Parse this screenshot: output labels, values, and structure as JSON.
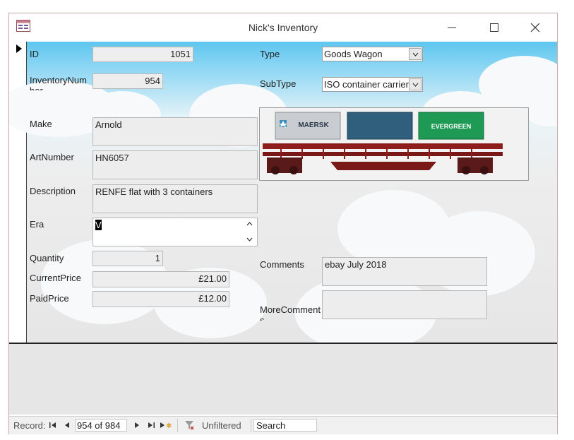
{
  "window": {
    "title": "Nick's Inventory"
  },
  "fields": {
    "id": {
      "label": "ID",
      "value": "1051"
    },
    "inventory_number": {
      "label": "InventoryNumber",
      "value": "954"
    },
    "make": {
      "label": "Make",
      "value": "Arnold"
    },
    "art_number": {
      "label": "ArtNumber",
      "value": "HN6057"
    },
    "description": {
      "label": "Description",
      "value": "RENFE flat with 3 containers"
    },
    "era": {
      "label": "Era",
      "value": "V"
    },
    "quantity": {
      "label": "Quantity",
      "value": "1"
    },
    "current_price": {
      "label": "CurrentPrice",
      "value": "£21.00"
    },
    "paid_price": {
      "label": "PaidPrice",
      "value": "£12.00"
    },
    "type": {
      "label": "Type",
      "value": "Goods Wagon"
    },
    "sub_type": {
      "label": "SubType",
      "value": "ISO container carrier"
    },
    "comments": {
      "label": "Comments",
      "value": "ebay July 2018"
    },
    "more_comments": {
      "label": "MoreComments",
      "value": ""
    }
  },
  "picture": {
    "containers": [
      "MAERSK",
      "",
      "EVERGREEN"
    ]
  },
  "navigation": {
    "record_label": "Record:",
    "record_position": "954 of 984",
    "filter_status": "Unfiltered",
    "search_placeholder": "Search"
  },
  "colors": {
    "sky": "#5ec6ef",
    "maersk": "#c9ccd0",
    "middle_container": "#2f5f7c",
    "evergreen": "#1f9a55",
    "wagon": "#8e1e1e"
  }
}
